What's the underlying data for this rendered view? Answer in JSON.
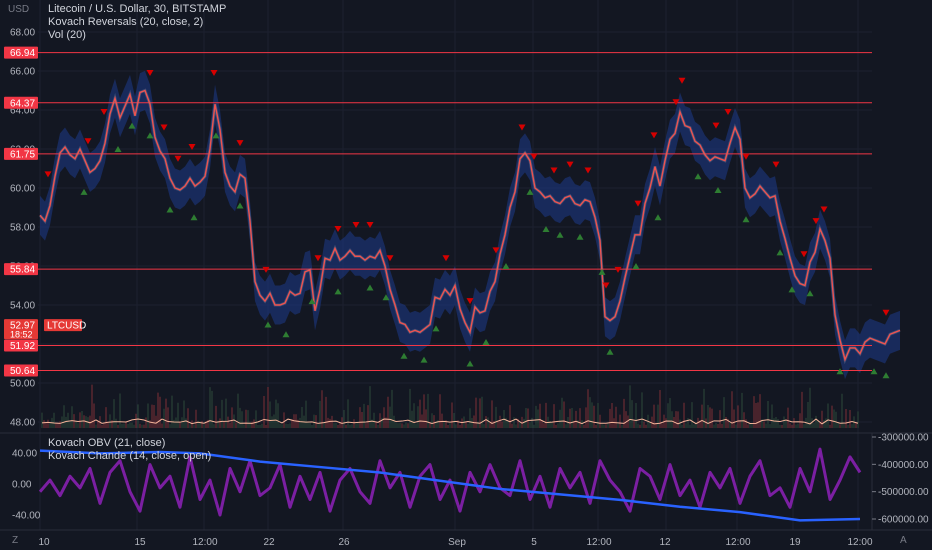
{
  "header": {
    "usd_label": "USD",
    "symbol_title": "Litecoin / U.S. Dollar, 30, BITSTAMP",
    "study1": "Kovach Reversals (20, close, 2)",
    "study2": "Vol (20)"
  },
  "lower_pane": {
    "study1": "Kovach OBV (21, close)",
    "study2": "Kovach Chande (14, close, open)"
  },
  "price_axis": {
    "ticks": [
      "68.00",
      "66.00",
      "64.00",
      "62.00",
      "60.00",
      "58.00",
      "56.00",
      "54.00",
      "52.00",
      "50.00",
      "48.00"
    ]
  },
  "levels": [
    "66.94",
    "64.37",
    "61.75",
    "55.84",
    "51.92",
    "50.64"
  ],
  "current_price": {
    "price": "52.97",
    "countdown": "18:52",
    "label": "LTCUSD"
  },
  "osc_axis": {
    "ticks": [
      "40.00",
      "0.00",
      "-40.00"
    ]
  },
  "obv_axis": {
    "ticks": [
      "-300000.00",
      "-400000.00",
      "-500000.00",
      "-600000.00"
    ]
  },
  "time_axis": {
    "ticks": [
      "10",
      "15",
      "12:00",
      "22",
      "26",
      "Sep",
      "5",
      "12:00",
      "12",
      "12:00",
      "19",
      "12:00"
    ]
  },
  "corner_left": "Z",
  "corner_right": "A",
  "colors": {
    "background": "#131722",
    "level_line": "#f23645",
    "kovach_band": "#1e3a8a",
    "price_line": "#ef5350",
    "sell_marker": "#d50000",
    "buy_marker": "#2e7d32",
    "obv_line": "#2962ff",
    "chande_line": "#7b1fa2"
  },
  "chart_data": {
    "type": "line",
    "price_series": {
      "ylim": [
        47.5,
        68.5
      ],
      "x": [
        0,
        5,
        10,
        15,
        20,
        25,
        30,
        35,
        40,
        45,
        50,
        55,
        60,
        65,
        70,
        75,
        80,
        85,
        90,
        95,
        100,
        105,
        110,
        115,
        120,
        125,
        130,
        135,
        140,
        145,
        150,
        155,
        160,
        165,
        170,
        175,
        180,
        185,
        190,
        195,
        200,
        205,
        210,
        215,
        220,
        225,
        230,
        235,
        240,
        245,
        250,
        255,
        260,
        265,
        270,
        275,
        280,
        285,
        290,
        295,
        300,
        305,
        310,
        315,
        320,
        325,
        330,
        335,
        340,
        345,
        350,
        355,
        360,
        365,
        370,
        375,
        380,
        385,
        390,
        395,
        400,
        405,
        410,
        415,
        420,
        425,
        430,
        435,
        440,
        445,
        450,
        455,
        460,
        465,
        470,
        475,
        480,
        485,
        490,
        495,
        500,
        505,
        510,
        515,
        520,
        525,
        530,
        535,
        540,
        545,
        550,
        555,
        560,
        565,
        570,
        575,
        580,
        585,
        590,
        595,
        600,
        605,
        610,
        615,
        620,
        625,
        630,
        635,
        640,
        645,
        650,
        655,
        660,
        665,
        670,
        675,
        680,
        685,
        690,
        695,
        700,
        705,
        710,
        715,
        720,
        725,
        730,
        735,
        740,
        745,
        750,
        755,
        760,
        765,
        770,
        775,
        780,
        785,
        790,
        795,
        800,
        805,
        810,
        815,
        820,
        825,
        830,
        835,
        840,
        845,
        850,
        855,
        860
      ],
      "close": [
        58.6,
        58.3,
        59.1,
        60.6,
        61.8,
        62.1,
        61.7,
        61.5,
        62.0,
        61.4,
        60.8,
        61.0,
        61.4,
        62.3,
        63.8,
        64.6,
        63.6,
        64.2,
        64.8,
        63.7,
        64.9,
        65.0,
        64.3,
        62.6,
        61.9,
        61.5,
        60.5,
        60.0,
        59.9,
        60.1,
        60.5,
        60.1,
        60.3,
        60.6,
        62.0,
        64.3,
        63.0,
        60.8,
        60.1,
        59.8,
        60.7,
        60.5,
        58.3,
        55.2,
        54.5,
        54.2,
        54.6,
        54.0,
        54.0,
        54.1,
        54.7,
        54.5,
        54.6,
        55.7,
        55.8,
        53.7,
        54.8,
        56.4,
        56.3,
        56.9,
        56.3,
        56.5,
        56.8,
        56.5,
        56.5,
        56.3,
        56.5,
        56.4,
        56.8,
        56.0,
        54.8,
        54.0,
        53.1,
        53.0,
        52.6,
        52.7,
        52.6,
        52.8,
        53.0,
        54.4,
        54.3,
        54.8,
        54.5,
        55.0,
        53.8,
        53.1,
        52.6,
        53.9,
        53.6,
        53.7,
        54.7,
        55.2,
        56.6,
        57.6,
        59.0,
        59.8,
        61.5,
        61.8,
        61.4,
        60.0,
        59.8,
        59.5,
        59.6,
        59.3,
        59.2,
        59.5,
        59.6,
        59.2,
        59.1,
        59.4,
        59.3,
        58.5,
        57.3,
        53.4,
        53.2,
        53.4,
        54.2,
        55.4,
        56.5,
        57.6,
        57.6,
        59.2,
        60.0,
        61.1,
        60.1,
        61.4,
        62.5,
        62.8,
        63.9,
        63.2,
        63.1,
        62.4,
        62.2,
        61.7,
        61.4,
        61.6,
        61.5,
        61.4,
        62.3,
        63.1,
        62.5,
        60.0,
        59.5,
        59.7,
        60.1,
        59.8,
        59.5,
        59.6,
        58.3,
        57.4,
        56.4,
        55.5,
        55.1,
        55.0,
        56.2,
        56.7,
        57.9,
        57.3,
        56.4,
        53.5,
        52.2,
        51.2,
        51.8,
        51.8,
        51.5,
        52.1,
        52.3,
        52.2,
        52.1,
        52.0,
        52.5,
        52.6,
        52.7
      ],
      "sell_markers_x": [
        8,
        48,
        64,
        110,
        124,
        138,
        152,
        174,
        200,
        226,
        278,
        298,
        316,
        330,
        350,
        406,
        430,
        456,
        482,
        494,
        514,
        530,
        548,
        566,
        578,
        598,
        614,
        636,
        642,
        676,
        688,
        706,
        736,
        764,
        776,
        784,
        846
      ],
      "buy_markers_x": [
        44,
        78,
        92,
        110,
        130,
        154,
        176,
        200,
        228,
        246,
        272,
        298,
        330,
        346,
        364,
        384,
        396,
        430,
        446,
        466,
        490,
        506,
        520,
        540,
        562,
        570,
        596,
        618,
        658,
        678,
        706,
        740,
        752,
        770,
        800,
        834,
        846
      ]
    },
    "kovach_obv": {
      "ylim": [
        -640000,
        -270000
      ],
      "x": [
        40,
        100,
        160,
        200,
        260,
        320,
        380,
        440,
        500,
        560,
        620,
        680,
        740,
        800,
        860
      ],
      "values": [
        -350000,
        -360000,
        -355000,
        -360000,
        -390000,
        -410000,
        -430000,
        -460000,
        -490000,
        -510000,
        -530000,
        -555000,
        -575000,
        -605000,
        -600000
      ]
    },
    "kovach_chande": {
      "ylim": [
        -60,
        60
      ],
      "x": [
        40,
        50,
        60,
        70,
        80,
        90,
        100,
        110,
        120,
        130,
        140,
        150,
        160,
        170,
        180,
        190,
        200,
        210,
        220,
        230,
        240,
        250,
        260,
        270,
        280,
        290,
        300,
        310,
        320,
        330,
        340,
        350,
        360,
        370,
        380,
        390,
        400,
        410,
        420,
        430,
        440,
        450,
        460,
        470,
        480,
        490,
        500,
        510,
        520,
        530,
        540,
        550,
        560,
        570,
        580,
        590,
        600,
        610,
        620,
        630,
        640,
        650,
        660,
        670,
        680,
        690,
        700,
        710,
        720,
        730,
        740,
        750,
        760,
        770,
        780,
        790,
        800,
        810,
        820,
        830,
        840,
        850,
        860
      ],
      "values": [
        -10,
        5,
        -15,
        10,
        -5,
        20,
        -25,
        15,
        30,
        -10,
        -35,
        25,
        -5,
        10,
        -30,
        35,
        -20,
        5,
        -40,
        20,
        -10,
        30,
        -15,
        -5,
        25,
        -30,
        10,
        -20,
        15,
        -35,
        5,
        20,
        -10,
        -25,
        30,
        -5,
        15,
        -30,
        10,
        25,
        -20,
        5,
        -35,
        15,
        -10,
        25,
        -5,
        -15,
        30,
        -20,
        10,
        -30,
        20,
        -5,
        15,
        -25,
        30,
        5,
        -10,
        -35,
        20,
        10,
        -20,
        25,
        -15,
        5,
        -30,
        15,
        -5,
        20,
        -25,
        10,
        30,
        -15,
        -5,
        -30,
        20,
        -10,
        45,
        -20,
        5,
        35,
        15
      ]
    }
  }
}
